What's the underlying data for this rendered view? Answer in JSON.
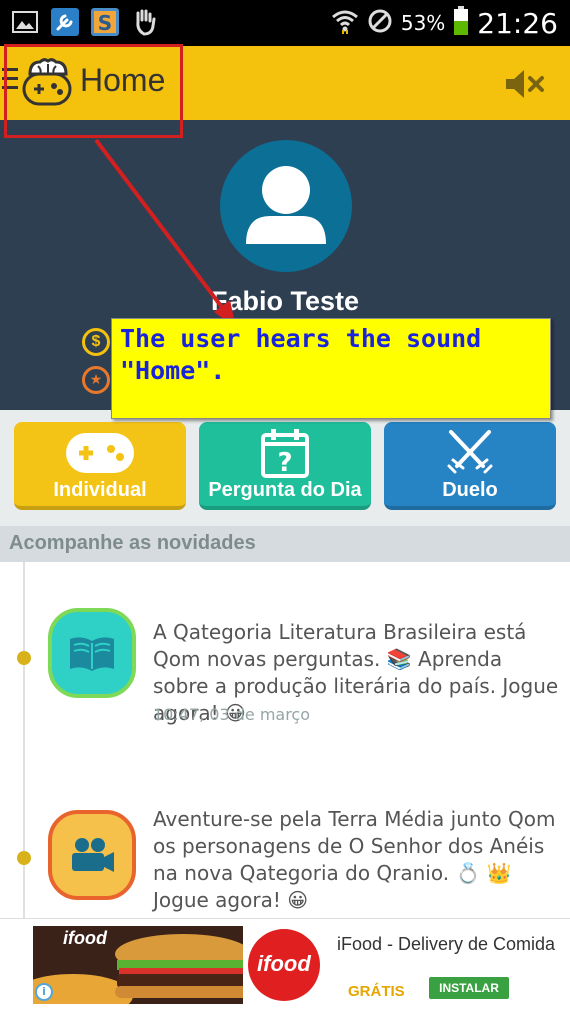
{
  "status_bar": {
    "battery_percent": "53%",
    "time": "21:26",
    "icons": [
      "image-icon",
      "wrench-icon",
      "s-app-icon",
      "hand-icon",
      "wifi-icon",
      "no-sim-icon",
      "battery-icon"
    ]
  },
  "app_bar": {
    "title": "Home",
    "icons": [
      "menu-icon",
      "qranio-logo-icon",
      "mute-icon"
    ],
    "colors": {
      "background": "#f4c20d"
    }
  },
  "profile": {
    "name": "Fabio Teste",
    "icons": [
      "avatar-icon",
      "coin-icon",
      "star-icon"
    ],
    "coin_symbol": "$",
    "star_symbol": "★"
  },
  "annotation": {
    "text": "The user hears the sound\n\"Home\".",
    "colors": {
      "background": "#ffff00",
      "text": "#1a24d8",
      "arrow": "#d21f1f"
    }
  },
  "actions": [
    {
      "label": "Individual",
      "icon": "gamepad-icon",
      "color": "#f3c316"
    },
    {
      "label": "Pergunta do Dia",
      "icon": "calendar-question-icon",
      "color": "#1fbf9c"
    },
    {
      "label": "Duelo",
      "icon": "crossed-swords-icon",
      "color": "#2684c4"
    }
  ],
  "feed": {
    "header": "Acompanhe as novidades",
    "items": [
      {
        "text": "A Qategoria Literatura Brasileira está Qom novas perguntas. 📚 Aprenda sobre a produção literária do país. Jogue agora! 😀",
        "time": "10:47, 03 de março",
        "icon": "open-book-icon",
        "icon_color": "#2fd0c6",
        "icon_border": "#7ed957"
      },
      {
        "text": "Aventure-se pela Terra Média junto Qom os personagens de O Senhor dos Anéis na nova Qategoria do Qranio. 💍 👑 Jogue agora! 😀",
        "icon": "movie-camera-icon",
        "icon_color": "#f6c14b",
        "icon_border": "#e8642c"
      }
    ]
  },
  "ad": {
    "title": "iFood - Delivery de Comida",
    "price": "GRÁTIS",
    "install_label": "INSTALAR",
    "brand_text": "ifood",
    "info_symbol": "i"
  }
}
